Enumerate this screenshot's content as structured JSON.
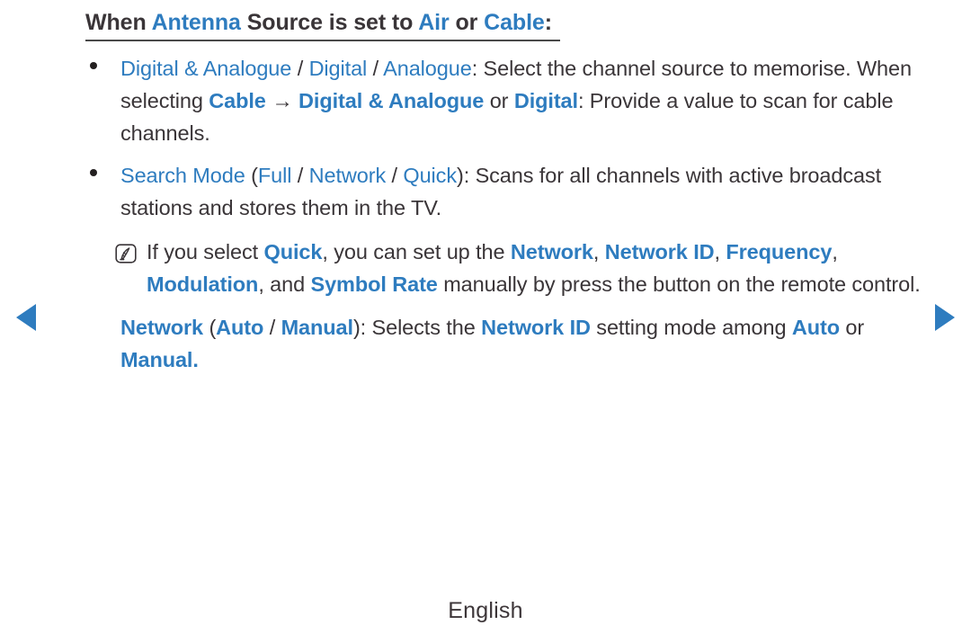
{
  "colors": {
    "accent_blue": "#2e7cbf",
    "body_text": "#3a3538",
    "title_text": "#2b2629",
    "rule": "#4a4a4a",
    "background": "#ffffff"
  },
  "title": {
    "segments": [
      {
        "text": "When ",
        "style": "dark-bold"
      },
      {
        "text": "Antenna",
        "style": "blue-bold"
      },
      {
        "text": " Source is set to ",
        "style": "dark-bold"
      },
      {
        "text": "Air",
        "style": "blue-bold"
      },
      {
        "text": " or ",
        "style": "dark-bold"
      },
      {
        "text": "Cable",
        "style": "blue-bold"
      },
      {
        "text": ":",
        "style": "dark-bold"
      }
    ],
    "plain": "When Antenna Source is set to Air or Cable:"
  },
  "bullets": [
    {
      "marker": "bullet-dot",
      "plain": "Digital & Analogue / Digital / Analogue: Select the channel source to memorise. When selecting Cable → Digital & Analogue or Digital: Provide a value to scan for cable channels.",
      "segments": [
        {
          "text": "Digital & Analogue",
          "style": "blue"
        },
        {
          "text": " / ",
          "style": "dark"
        },
        {
          "text": "Digital",
          "style": "blue"
        },
        {
          "text": " / ",
          "style": "dark"
        },
        {
          "text": "Analogue",
          "style": "blue"
        },
        {
          "text": ": Select the channel source to memorise. When selecting ",
          "style": "dark"
        },
        {
          "text": "Cable",
          "style": "blue-bold"
        },
        {
          "text": " → ",
          "style": "dark"
        },
        {
          "text": "Digital & Analogue",
          "style": "blue-bold"
        },
        {
          "text": " or ",
          "style": "dark"
        },
        {
          "text": "Digital",
          "style": "blue-bold"
        },
        {
          "text": ": Provide a value to scan for cable channels.",
          "style": "dark"
        }
      ]
    },
    {
      "marker": "bullet-dot",
      "plain": "Search Mode (Full / Network / Quick): Scans for all channels with active broadcast stations and stores them in the TV.",
      "segments": [
        {
          "text": "Search Mode",
          "style": "blue"
        },
        {
          "text": " (",
          "style": "dark"
        },
        {
          "text": "Full",
          "style": "blue"
        },
        {
          "text": " / ",
          "style": "dark"
        },
        {
          "text": "Network",
          "style": "blue"
        },
        {
          "text": " / ",
          "style": "dark"
        },
        {
          "text": "Quick",
          "style": "blue"
        },
        {
          "text": "): Scans for all channels with active broadcast stations and stores them in the TV.",
          "style": "dark"
        }
      ]
    }
  ],
  "note": {
    "icon": "note-pen-icon",
    "plain": "If you select Quick, you can set up the Network, Network ID, Frequency, Modulation, and Symbol Rate manually by press the button on the remote control.",
    "segments": [
      {
        "text": "If you select ",
        "style": "dark"
      },
      {
        "text": "Quick",
        "style": "blue-bold"
      },
      {
        "text": ", you can set up the ",
        "style": "dark"
      },
      {
        "text": "Network",
        "style": "blue-bold"
      },
      {
        "text": ", ",
        "style": "dark"
      },
      {
        "text": "Network ID",
        "style": "blue-bold"
      },
      {
        "text": ", ",
        "style": "dark"
      },
      {
        "text": "Frequency",
        "style": "blue-bold"
      },
      {
        "text": ", ",
        "style": "dark"
      },
      {
        "text": "Modulation",
        "style": "blue-bold"
      },
      {
        "text": ", and ",
        "style": "dark"
      },
      {
        "text": "Symbol Rate",
        "style": "blue-bold"
      },
      {
        "text": " manually by press the button on the remote control.",
        "style": "dark"
      }
    ]
  },
  "closing_paragraph": {
    "plain": "Network (Auto / Manual): Selects the Network ID setting mode among Auto or Manual.",
    "segments": [
      {
        "text": "Network",
        "style": "blue-bold"
      },
      {
        "text": " (",
        "style": "dark"
      },
      {
        "text": "Auto",
        "style": "blue-bold"
      },
      {
        "text": " / ",
        "style": "dark"
      },
      {
        "text": "Manual",
        "style": "blue-bold"
      },
      {
        "text": "): Selects the ",
        "style": "dark"
      },
      {
        "text": "Network ID",
        "style": "blue-bold"
      },
      {
        "text": " setting mode among ",
        "style": "dark"
      },
      {
        "text": "Auto",
        "style": "blue-bold"
      },
      {
        "text": " or ",
        "style": "dark"
      },
      {
        "text": "Manual.",
        "style": "blue-bold"
      }
    ]
  },
  "navigation": {
    "prev_label": "◀",
    "prev_name": "previous-page-arrow",
    "next_label": "▶",
    "next_name": "next-page-arrow"
  },
  "footer": {
    "language": "English"
  }
}
